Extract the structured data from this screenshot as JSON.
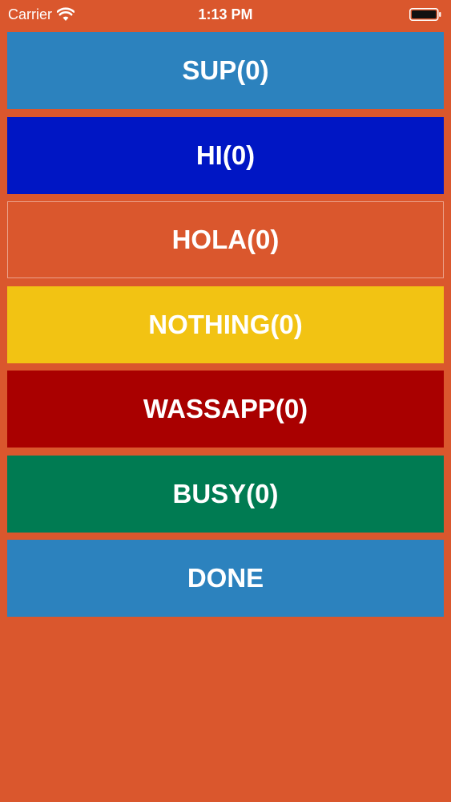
{
  "status_bar": {
    "carrier": "Carrier",
    "time": "1:13 PM"
  },
  "buttons": [
    {
      "label": "SUP(0)",
      "color": "#2C82BE"
    },
    {
      "label": "HI(0)",
      "color": "#0016C4"
    },
    {
      "label": "HOLA(0)",
      "color": "#DA572D",
      "outlined": true
    },
    {
      "label": "NOTHING(0)",
      "color": "#F2C313"
    },
    {
      "label": "WASSAPP(0)",
      "color": "#A90000"
    },
    {
      "label": "BUSY(0)",
      "color": "#007B52"
    },
    {
      "label": "DONE",
      "color": "#2C82BE"
    }
  ],
  "colors": {
    "background": "#DA572D",
    "text": "#FFFFFF"
  }
}
